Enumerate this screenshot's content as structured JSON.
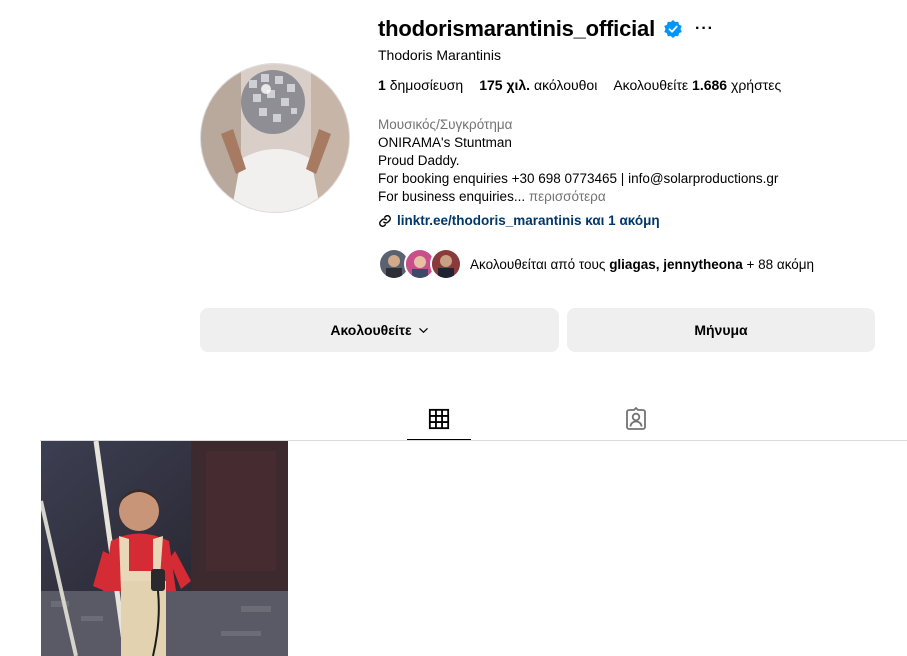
{
  "profile": {
    "username": "thodorismarantinis_official",
    "full_name": "Thodoris Marantinis",
    "verified": true,
    "stats": {
      "posts_count": "1",
      "posts_label": "δημοσίευση",
      "followers_count": "175 χιλ.",
      "followers_label": "ακόλουθοι",
      "following_prefix": "Ακολουθείτε",
      "following_count": "1.686",
      "following_label": "χρήστες"
    },
    "category": "Μουσικός/Συγκρότημα",
    "bio_lines": [
      "ONIRAMA's Stuntman",
      "Proud Daddy.",
      "For booking enquiries +30 698 0773465 | info@solarproductions.gr",
      "For business enquiries..."
    ],
    "bio_more": "περισσότερα",
    "link_text": "linktr.ee/thodoris_marantinis και 1 ακόμη",
    "followed_by": {
      "prefix": "Ακολουθείται από τους",
      "users": "gliagas, jennytheona",
      "suffix": "+ 88 ακόμη"
    }
  },
  "actions": {
    "follow_label": "Ακολουθείτε",
    "message_label": "Μήνυμα"
  },
  "tabs": [
    {
      "icon": "grid-icon",
      "active": true
    },
    {
      "icon": "tagged-icon",
      "active": false
    }
  ],
  "colors": {
    "verified_blue": "#0095f6",
    "link_blue": "#00376b",
    "muted_gray": "#737373",
    "button_bg": "#efefef"
  }
}
